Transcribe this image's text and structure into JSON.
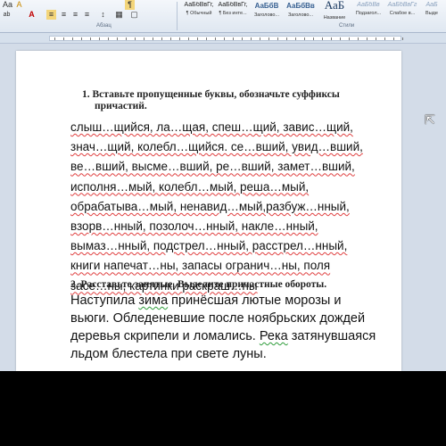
{
  "ribbon": {
    "paragraph_group_label": "Абзац",
    "styles_group_label": "Стили",
    "format_buttons_row1": [
      "Aa",
      "A",
      "A"
    ],
    "format_buttons_row2": [
      "ab",
      "A",
      "≡",
      "≡",
      "≡",
      "≡",
      "↕",
      "▦",
      "▢"
    ],
    "styles": [
      {
        "sample": "АаБбВвГг,",
        "name": "¶ Обычный"
      },
      {
        "sample": "АаБбВвГг,",
        "name": "¶ Без инте..."
      },
      {
        "sample": "АаБбВ",
        "name": "Заголово..."
      },
      {
        "sample": "АаБбВв",
        "name": "Заголово..."
      },
      {
        "sample": "АаБ",
        "name": "Название"
      },
      {
        "sample": "АаБбВв",
        "name": "Подзагол..."
      },
      {
        "sample": "АаБбВвГг",
        "name": "Слабое в..."
      },
      {
        "sample": "АаБ",
        "name": "Выде"
      }
    ]
  },
  "document": {
    "task1_line1": "1.  Вставьте пропущенные буквы, обозначьте суффиксы",
    "task1_line2": "причастий.",
    "word_lines": [
      "слыш…щийся, ла…щая, спеш…щий, завис…щий,",
      "знач…щий, колебл…щийся. се…вший, увид…вший,",
      "ве…вший, высме…вший, ре…вший, замет…вший,",
      "исполня…мый, колебл…мый, реша…мый,",
      "обрабатыва…мый, ненавид…мый,разбуж…нный,",
      "взорв…нный, позолоч…нный, накле…нный,",
      "вымаз…нный, подстрел…нный, расстрел…нный,",
      "книги напечат…ны, запасы огранич…ны, поля",
      "засе…ны, картинки раскраш…ны"
    ],
    "task2_heading": "2. Расставьте запятые.  Выделите причастные  обороты.",
    "text2": {
      "l1_pre": "Наступила ",
      "l1_u": "зима",
      "l1_post": " принёсшая лютые морозы и",
      "l2": "вьюги. Обледеневшие после ноябрьских дождей",
      "l3_pre": "деревья скрипели и ломались. ",
      "l3_u": "Река",
      "l3_post": " затянувшаяся",
      "l4": "льдом блестела при свете луны."
    }
  },
  "colors": {
    "spell_error": "#e04040",
    "grammar_mark": "#2e9c3a",
    "doc_background": "#d3dce8"
  }
}
